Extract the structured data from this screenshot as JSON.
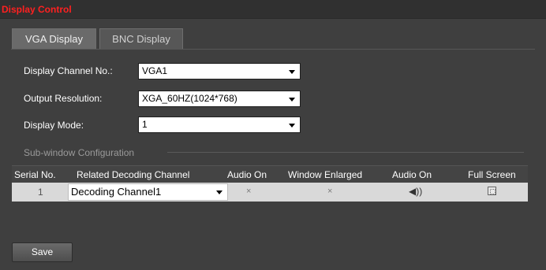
{
  "title": "Display Control",
  "tabs": [
    {
      "label": "VGA Display",
      "active": true
    },
    {
      "label": "BNC Display",
      "active": false
    }
  ],
  "form": {
    "channel": {
      "label": "Display Channel No.:",
      "value": "VGA1"
    },
    "resolution": {
      "label": "Output Resolution:",
      "value": "XGA_60HZ(1024*768)"
    },
    "mode": {
      "label": "Display Mode:",
      "value": "1"
    }
  },
  "subwindow": {
    "title": "Sub-window Configuration",
    "columns": [
      "Serial No.",
      "Related Decoding Channel",
      "Audio On",
      "Window Enlarged",
      "Audio On",
      "Full Screen"
    ],
    "rows": [
      {
        "serial": "1",
        "channel": "Decoding Channel1",
        "audio_on": "×",
        "window_enlarged": "×",
        "audio_icon": "speaker-icon",
        "full_screen_icon": "fullscreen-icon"
      }
    ]
  },
  "save_label": "Save",
  "colors": {
    "title": "#ff2020",
    "background": "#3f3f3f",
    "row": "#d9d9d9"
  }
}
